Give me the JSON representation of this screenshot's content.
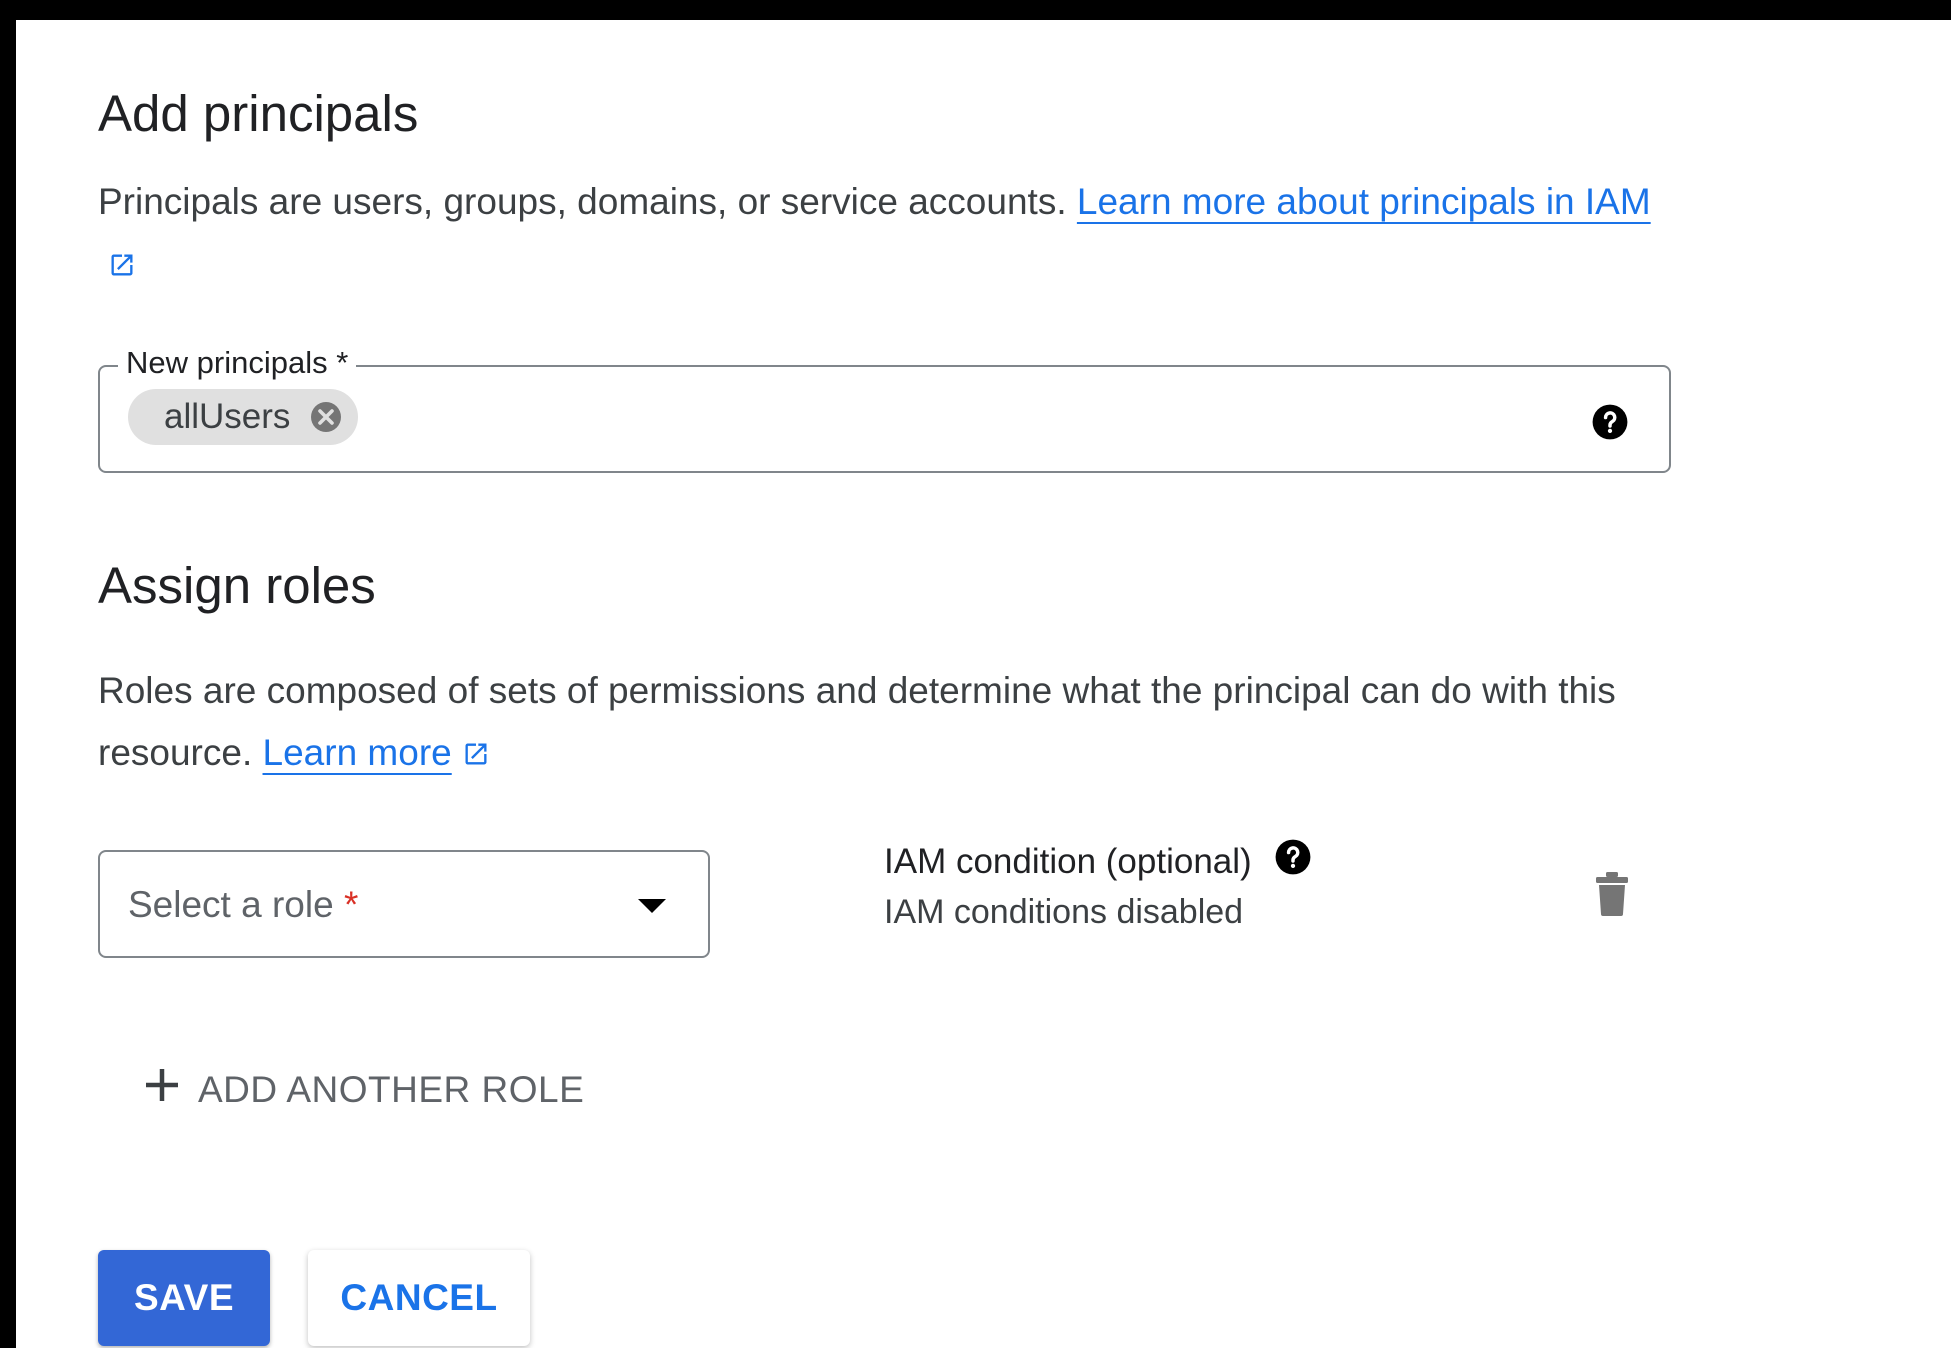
{
  "add_principals": {
    "heading": "Add principals",
    "description": "Principals are users, groups, domains, or service accounts.",
    "link_text": "Learn more about principals in IAM",
    "field": {
      "label": "New principals *",
      "chips": [
        "allUsers"
      ]
    }
  },
  "assign_roles": {
    "heading": "Assign roles",
    "description": "Roles are composed of sets of permissions and determine what the principal can do with this resource.",
    "link_text": "Learn more",
    "role_select": {
      "placeholder": "Select a role",
      "required_marker": "*"
    },
    "iam_condition": {
      "title": "IAM condition (optional)",
      "status": "IAM conditions disabled"
    },
    "add_another_role_label": "ADD ANOTHER ROLE"
  },
  "actions": {
    "save_label": "SAVE",
    "cancel_label": "CANCEL"
  },
  "icons": {
    "external_link": "open-in-new-icon",
    "help": "help-icon",
    "chip_remove": "cancel-icon",
    "dropdown": "arrow-drop-down-icon",
    "delete": "trash-icon",
    "add": "plus-icon"
  },
  "colors": {
    "primary": "#3367d6",
    "link": "#1a73e8",
    "required": "#d93025"
  }
}
